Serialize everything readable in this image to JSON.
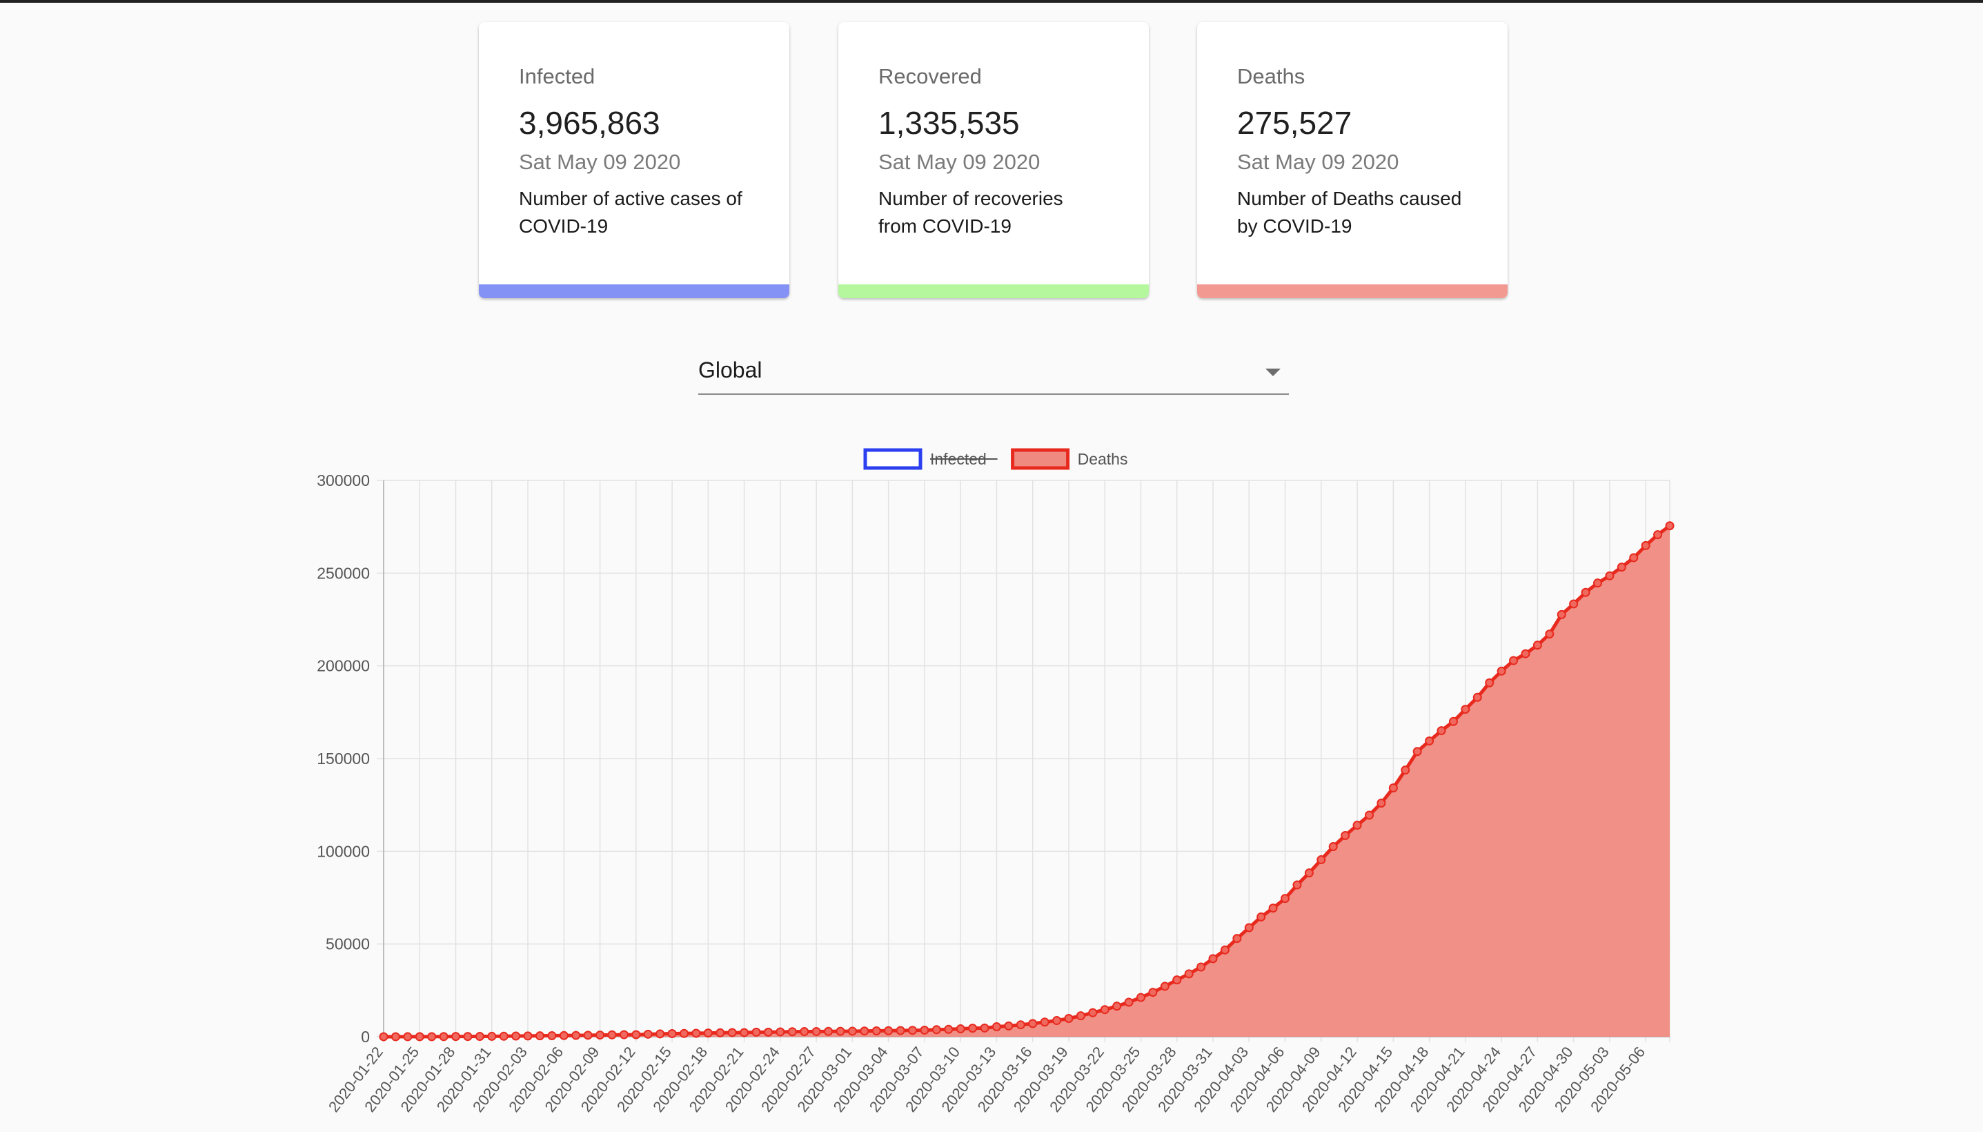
{
  "cards": [
    {
      "label": "Infected",
      "value": "3,965,863",
      "date": "Sat May 09 2020",
      "desc_line1": "Number of active cases of",
      "desc_line2": "COVID-19",
      "color": "#8592f5"
    },
    {
      "label": "Recovered",
      "value": "1,335,535",
      "date": "Sat May 09 2020",
      "desc_line1": "Number of recoveries",
      "desc_line2": "from COVID-19",
      "color": "#b4f79c"
    },
    {
      "label": "Deaths",
      "value": "275,527",
      "date": "Sat May 09 2020",
      "desc_line1": "Number of Deaths caused",
      "desc_line2": "by COVID-19",
      "color": "#f29a92"
    }
  ],
  "country_select": {
    "value": "Global",
    "icon": "chevron-down-icon"
  },
  "chart_data": {
    "type": "area",
    "title": "",
    "xlabel": "",
    "ylabel": "",
    "ylim": [
      0,
      300000
    ],
    "y_ticks": [
      0,
      50000,
      100000,
      150000,
      200000,
      250000,
      300000
    ],
    "grid": true,
    "legend_position": "top",
    "legend": [
      {
        "name": "Infected",
        "color": "#2b3ff0",
        "hidden": true
      },
      {
        "name": "Deaths",
        "color": "#e8291e",
        "hidden": false
      }
    ],
    "x_tick_labels": [
      "2020-01-22",
      "2020-01-25",
      "2020-01-28",
      "2020-01-31",
      "2020-02-03",
      "2020-02-06",
      "2020-02-09",
      "2020-02-12",
      "2020-02-15",
      "2020-02-18",
      "2020-02-21",
      "2020-02-24",
      "2020-02-27",
      "2020-03-01",
      "2020-03-04",
      "2020-03-07",
      "2020-03-10",
      "2020-03-13",
      "2020-03-16",
      "2020-03-19",
      "2020-03-22",
      "2020-03-25",
      "2020-03-28",
      "2020-03-31",
      "2020-04-03",
      "2020-04-06",
      "2020-04-09",
      "2020-04-12",
      "2020-04-15",
      "2020-04-18",
      "2020-04-21",
      "2020-04-24",
      "2020-04-27",
      "2020-04-30",
      "2020-05-03",
      "2020-05-06"
    ],
    "x_start": "2020-01-22",
    "x_end": "2020-05-09",
    "series": [
      {
        "name": "Deaths",
        "color": "#e8291e",
        "fill": "#ef8a80",
        "values": [
          17,
          18,
          26,
          42,
          56,
          82,
          131,
          133,
          171,
          213,
          259,
          362,
          426,
          492,
          564,
          634,
          719,
          806,
          906,
          1013,
          1113,
          1118,
          1371,
          1523,
          1666,
          1770,
          1868,
          2007,
          2122,
          2247,
          2251,
          2458,
          2469,
          2629,
          2708,
          2770,
          2814,
          2872,
          2941,
          2996,
          3085,
          3160,
          3254,
          3348,
          3460,
          3558,
          3802,
          3988,
          4262,
          4615,
          4720,
          5404,
          5819,
          6440,
          7126,
          7905,
          8733,
          9867,
          11299,
          12973,
          14623,
          16497,
          18615,
          21181,
          23970,
          27198,
          30652,
          33925,
          37582,
          42107,
          46809,
          52983,
          58787,
          64606,
          69374,
          74565,
          81865,
          88338,
          95455,
          102525,
          108503,
          114091,
          119482,
          125984,
          134176,
          143800,
          153821,
          159509,
          165044,
          169986,
          176583,
          183027,
          190858,
          197159,
          202846,
          206544,
          211167,
          217153,
          227638,
          233388,
          239604,
          244664,
          248559,
          253240,
          258333,
          264866,
          270740,
          275527
        ]
      }
    ]
  }
}
